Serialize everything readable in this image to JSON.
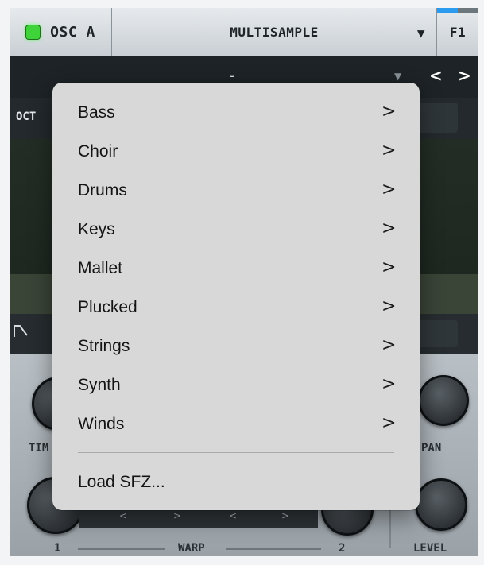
{
  "header": {
    "osc_label": "OSC A",
    "osc_led_color": "#3fd33a",
    "type_label": "MULTISAMPLE",
    "type_arrow": "▼",
    "f1_label": "F1"
  },
  "sample_row": {
    "value": "-",
    "dropdown_arrow": "▼",
    "prev": "<",
    "next": ">"
  },
  "params": {
    "oct_label": "OCT"
  },
  "knobs": {
    "time_label": "TIM",
    "pan_label": "PAN",
    "level_label": "LEVEL"
  },
  "warp": {
    "label": "WARP",
    "left_num": "1",
    "right_num": "2",
    "arrows": [
      "<",
      ">",
      "<",
      ">"
    ]
  },
  "menu": {
    "items": [
      {
        "label": "Bass",
        "chevron": ">"
      },
      {
        "label": "Choir",
        "chevron": ">"
      },
      {
        "label": "Drums",
        "chevron": ">"
      },
      {
        "label": "Keys",
        "chevron": ">"
      },
      {
        "label": "Mallet",
        "chevron": ">"
      },
      {
        "label": "Plucked",
        "chevron": ">"
      },
      {
        "label": "Strings",
        "chevron": ">"
      },
      {
        "label": "Synth",
        "chevron": ">"
      },
      {
        "label": "Winds",
        "chevron": ">"
      }
    ],
    "load_label": "Load SFZ..."
  }
}
